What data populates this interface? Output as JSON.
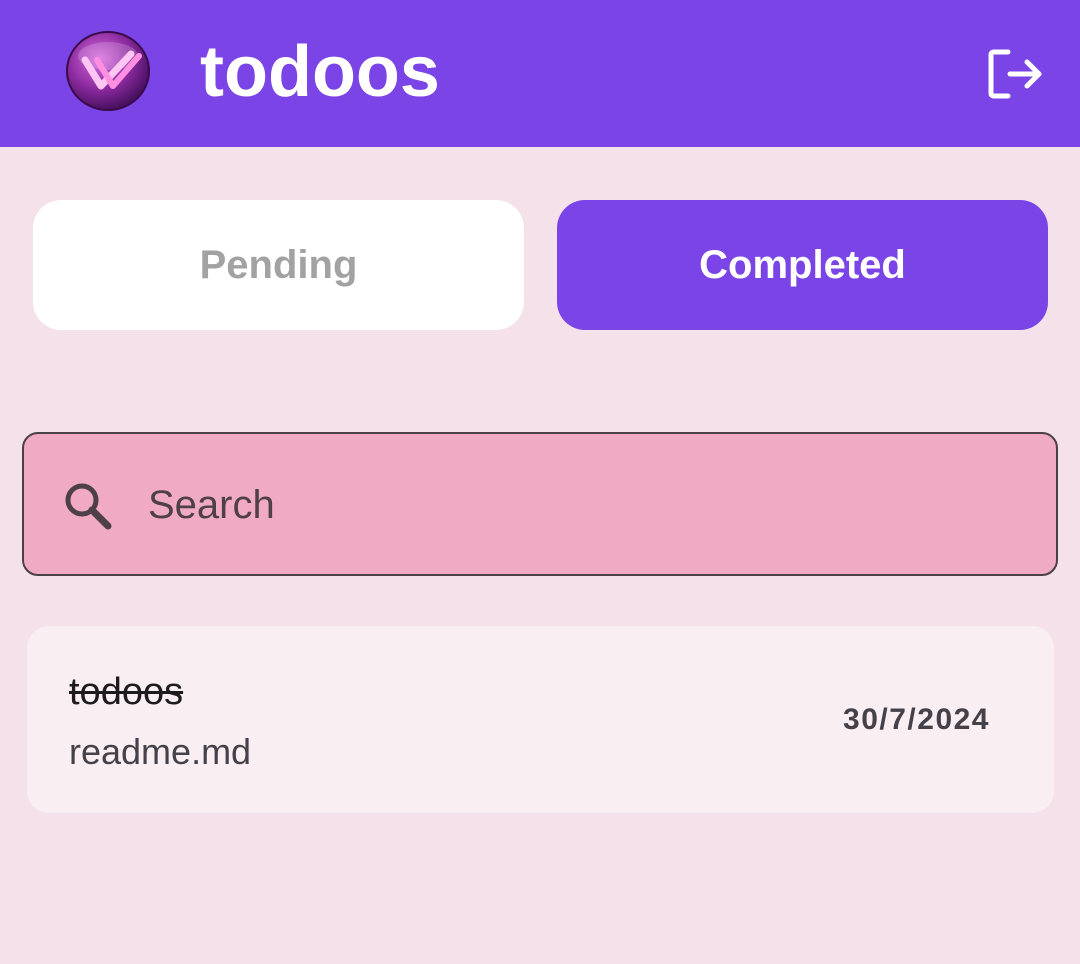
{
  "app": {
    "title": "todoos"
  },
  "icons": {
    "logo": "double-check-logo",
    "logout": "logout-icon",
    "search": "search-icon"
  },
  "colors": {
    "primary": "#7a44e6",
    "background": "#f4e1e9",
    "search_fill": "#f0aac3",
    "card": "#f9eff3"
  },
  "tabs": [
    {
      "label": "Pending",
      "selected": false
    },
    {
      "label": "Completed",
      "selected": true
    }
  ],
  "search": {
    "placeholder": "Search"
  },
  "todos": [
    {
      "title": "todoos",
      "subtitle": "readme.md",
      "date": "30/7/2024",
      "completed": true
    }
  ]
}
